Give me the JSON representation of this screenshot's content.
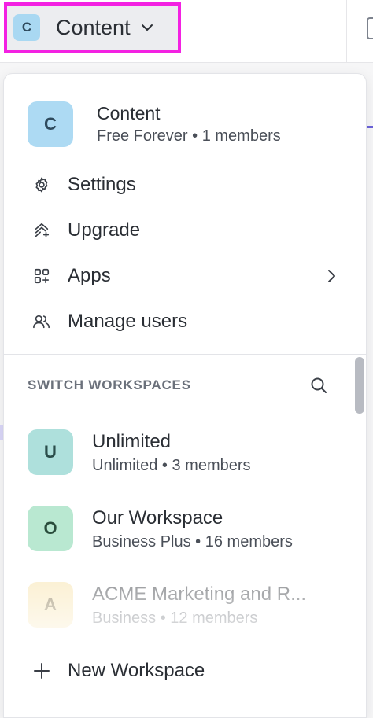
{
  "workspace_button": {
    "avatar_letter": "C",
    "name": "Content",
    "icon": "chevron-down-icon"
  },
  "current_workspace": {
    "avatar_letter": "C",
    "name": "Content",
    "plan_line": "Free Forever • 1 members",
    "avatar_color": "#addaf3"
  },
  "menu": [
    {
      "label": "Settings",
      "icon": "gear-icon"
    },
    {
      "label": "Upgrade",
      "icon": "upgrade-icon"
    },
    {
      "label": "Apps",
      "icon": "apps-grid-icon",
      "submenu": true
    },
    {
      "label": "Manage users",
      "icon": "users-icon"
    }
  ],
  "switch": {
    "header": "SWITCH WORKSPACES",
    "search_icon": "search-icon",
    "workspaces": [
      {
        "avatar_letter": "U",
        "name": "Unlimited",
        "plan_line": "Unlimited • 3 members",
        "avatar_color": "#aee0dc",
        "avatar_text_color": "#2a4d4a"
      },
      {
        "avatar_letter": "O",
        "name": "Our Workspace",
        "plan_line": "Business Plus • 16 members",
        "avatar_color": "#b9e8d1",
        "avatar_text_color": "#2a4d3c"
      },
      {
        "avatar_letter": "A",
        "name": "ACME Marketing and R...",
        "plan_line": "Business • 12 members",
        "avatar_color": "#f7e1a6",
        "avatar_text_color": "#6d5a2a"
      }
    ]
  },
  "new_workspace": {
    "label": "New Workspace",
    "icon": "plus-icon"
  },
  "colors": {
    "highlight_border": "#f321e2",
    "accent": "#6b63d9"
  }
}
